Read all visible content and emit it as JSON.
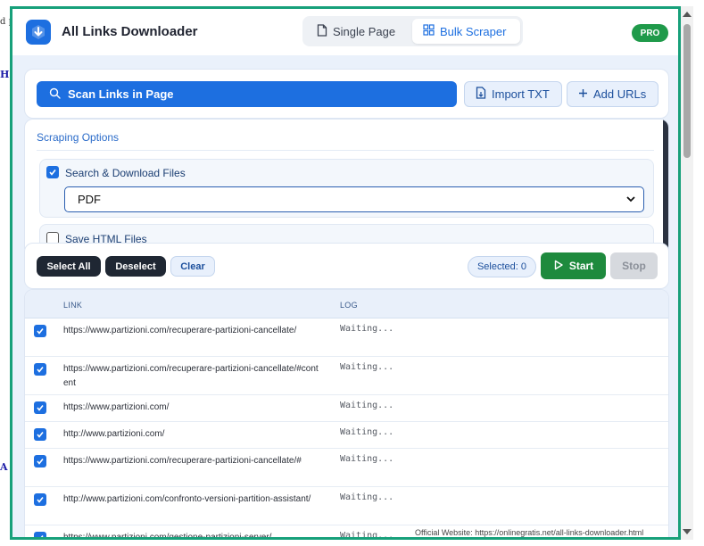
{
  "background": {
    "fragments": [
      "d p",
      "H",
      "A"
    ]
  },
  "header": {
    "title": "All Links Downloader",
    "tabs": [
      {
        "label": "Single Page",
        "icon": "file-icon",
        "active": false
      },
      {
        "label": "Bulk Scraper",
        "icon": "grid-icon",
        "active": true
      }
    ],
    "badge": "PRO"
  },
  "actions": {
    "scan_label": "Scan Links in Page",
    "import_label": "Import TXT",
    "add_label": "Add URLs"
  },
  "options": {
    "title": "Scraping Options",
    "search_download": {
      "label": "Search & Download Files",
      "checked": true
    },
    "file_type": "PDF",
    "save_html": {
      "label": "Save HTML Files",
      "checked": false
    }
  },
  "controls": {
    "select_all": "Select All",
    "deselect": "Deselect",
    "clear": "Clear",
    "selected": "Selected: 0",
    "start": "Start",
    "stop": "Stop"
  },
  "table": {
    "headers": {
      "link": "LINK",
      "log": "LOG"
    },
    "rows": [
      {
        "link": "https://www.partizioni.com/recuperare-partizioni-cancellate/",
        "log": "Waiting...",
        "checked": true
      },
      {
        "link": "https://www.partizioni.com/recuperare-partizioni-cancellate/#content",
        "log": "Waiting...",
        "checked": true
      },
      {
        "link": "https://www.partizioni.com/",
        "log": "Waiting...",
        "checked": true
      },
      {
        "link": "http://www.partizioni.com/",
        "log": "Waiting...",
        "checked": true
      },
      {
        "link": "https://www.partizioni.com/recuperare-partizioni-cancellate/#",
        "log": "Waiting...",
        "checked": true
      },
      {
        "link": "http://www.partizioni.com/confronto-versioni-partition-assistant/",
        "log": "Waiting...",
        "checked": true
      },
      {
        "link": "https://www.partizioni.com/gestione-partizioni-server/",
        "log": "Waiting...",
        "checked": true
      }
    ]
  },
  "footer": {
    "note": "Official Website: https://onlinegratis.net/all-links-downloader.html"
  },
  "colors": {
    "frame": "#17a07a",
    "primary": "#1d6fe0",
    "success": "#1e8a3d",
    "pro": "#1f9a4a"
  }
}
